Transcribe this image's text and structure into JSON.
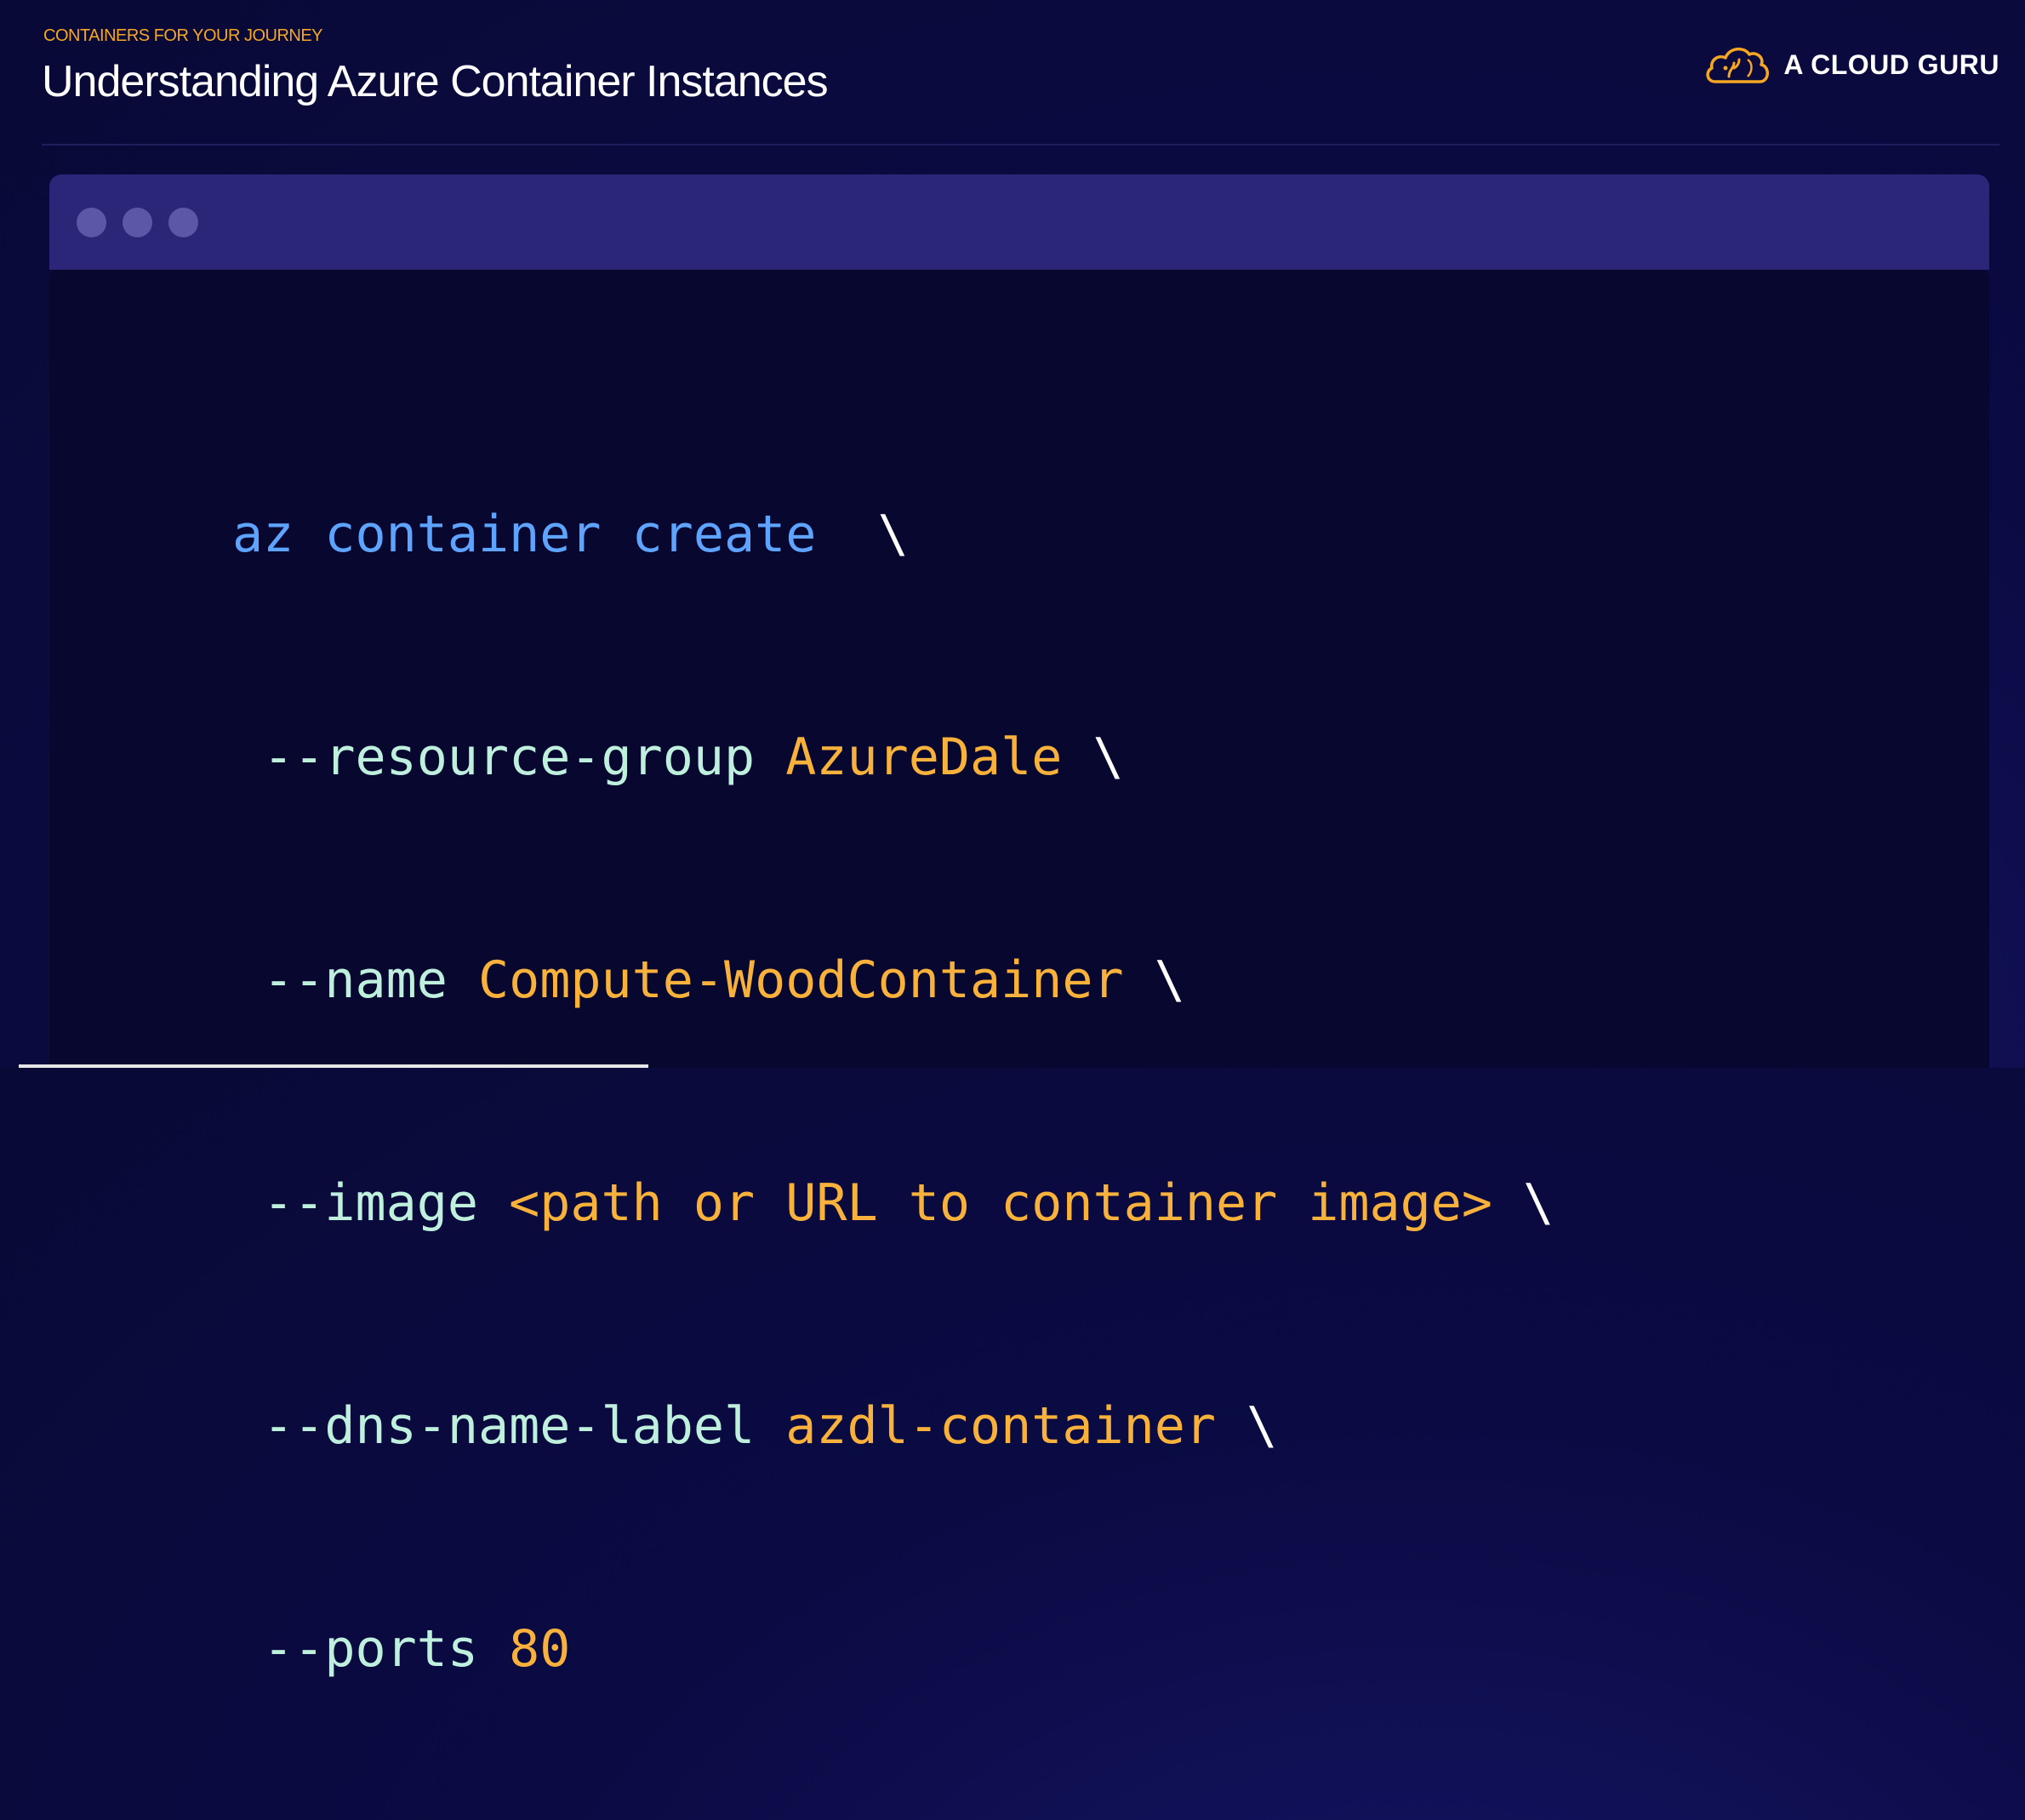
{
  "header": {
    "kicker": "CONTAINERS FOR YOUR JOURNEY",
    "title": "Understanding Azure Container Instances"
  },
  "brand": {
    "name": "A CLOUD GURU",
    "icon": "cloud-logo-icon",
    "accent_color": "#f5a623"
  },
  "terminal": {
    "dots": [
      "window-dot",
      "window-dot",
      "window-dot"
    ],
    "lines": [
      {
        "indent": "",
        "cmd": "az container create",
        "flag": "",
        "val": "",
        "cont": "  \\"
      },
      {
        "indent": " ",
        "cmd": "",
        "flag": "--resource-group ",
        "val": "AzureDale",
        "cont": " \\"
      },
      {
        "indent": " ",
        "cmd": "",
        "flag": "--name ",
        "val": "Compute-WoodContainer",
        "cont": " \\"
      },
      {
        "indent": " ",
        "cmd": "",
        "flag": "--image ",
        "val": "<path or URL to container image>",
        "cont": " \\"
      },
      {
        "indent": " ",
        "cmd": "",
        "flag": "--dns-name-label ",
        "val": "azdl-container",
        "cont": " \\"
      },
      {
        "indent": " ",
        "cmd": "",
        "flag": "--ports ",
        "val": "80",
        "cont": ""
      }
    ]
  },
  "colors": {
    "command": "#5ea4ff",
    "flag": "#bff0dd",
    "value": "#f8b23b",
    "background": "#0b0b45"
  }
}
